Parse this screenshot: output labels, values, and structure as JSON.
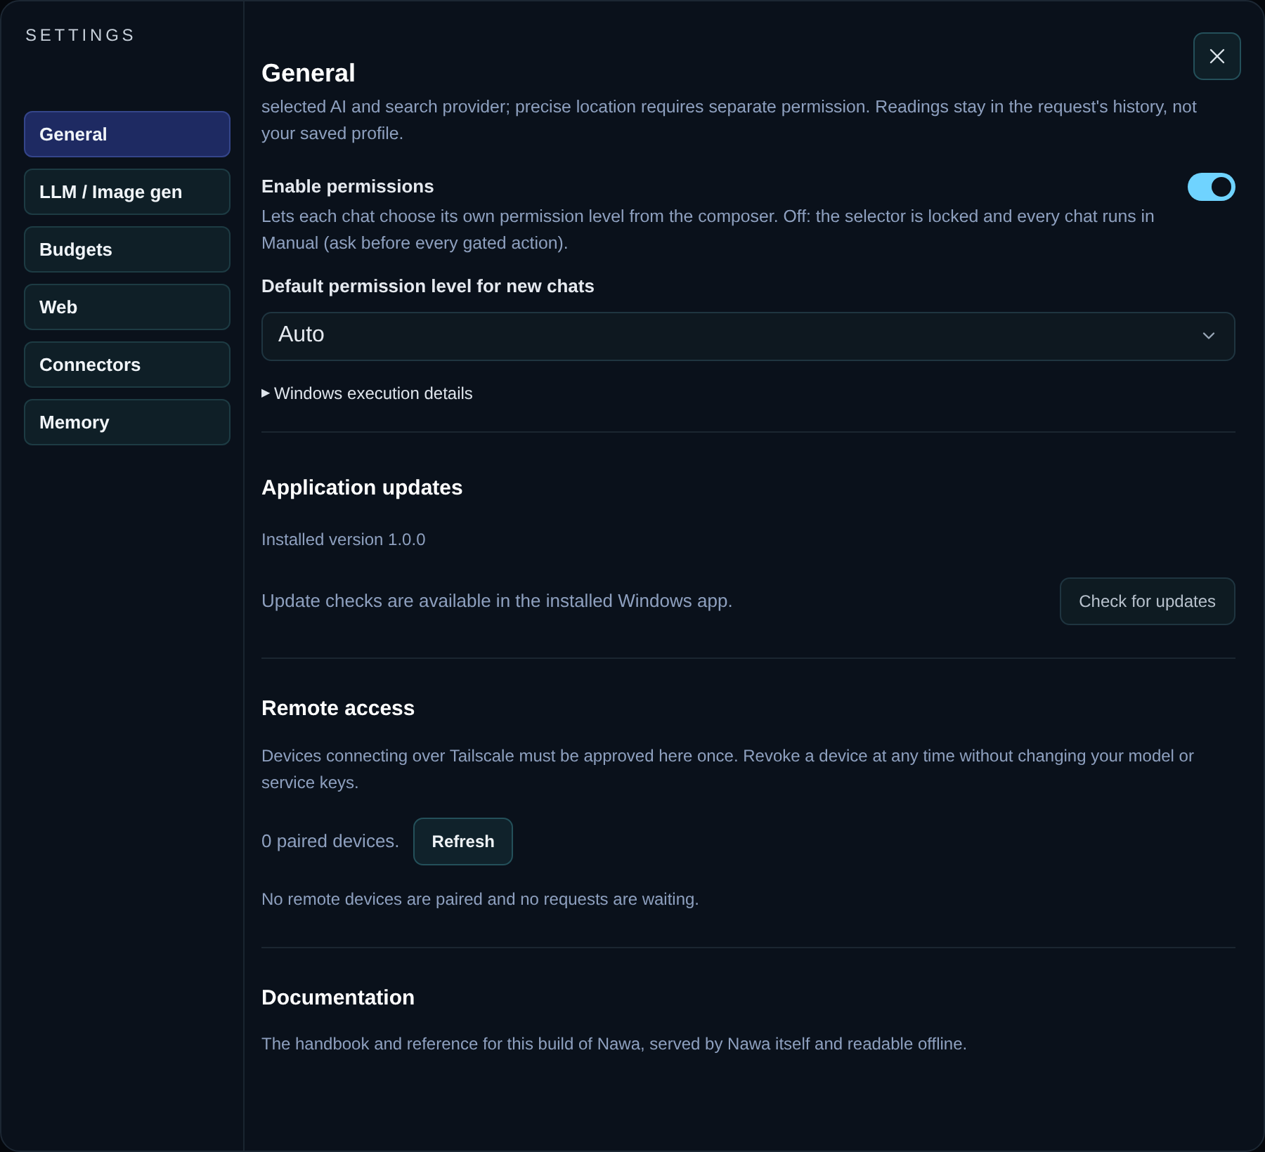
{
  "window": {
    "title": "SETTINGS"
  },
  "sidebar": {
    "items": [
      {
        "label": "General",
        "selected": true
      },
      {
        "label": "LLM / Image gen",
        "selected": false
      },
      {
        "label": "Budgets",
        "selected": false
      },
      {
        "label": "Web",
        "selected": false
      },
      {
        "label": "Connectors",
        "selected": false
      },
      {
        "label": "Memory",
        "selected": false
      }
    ]
  },
  "page": {
    "title": "General",
    "intro": "selected AI and search provider; precise location requires separate permission. Readings stay in the request's history, not your saved profile.",
    "permissions": {
      "label": "Enable permissions",
      "on": true,
      "description": "Lets each chat choose its own permission level from the composer. Off: the selector is locked and every chat runs in Manual (ask before every gated action)."
    },
    "default_level": {
      "label": "Default permission level for new chats",
      "value": "Auto"
    },
    "details": {
      "marker": "▶",
      "label": "Windows execution details",
      "expanded": false
    },
    "sections": [
      {
        "title": "Application updates",
        "version": "Installed version 1.0.0",
        "note": "Update checks are available in the installed Windows app.",
        "button": "Check for updates"
      },
      {
        "title": "Remote access",
        "description": "Devices connecting over Tailscale must be approved here once. Revoke a device at any time without changing your model or service keys.",
        "count": "0 paired devices.",
        "button": "Refresh",
        "status": "No remote devices are paired and no requests are waiting."
      },
      {
        "title": "Documentation",
        "description": "The handbook and reference for this build of Nawa, served by Nawa itself and readable offline."
      }
    ]
  }
}
